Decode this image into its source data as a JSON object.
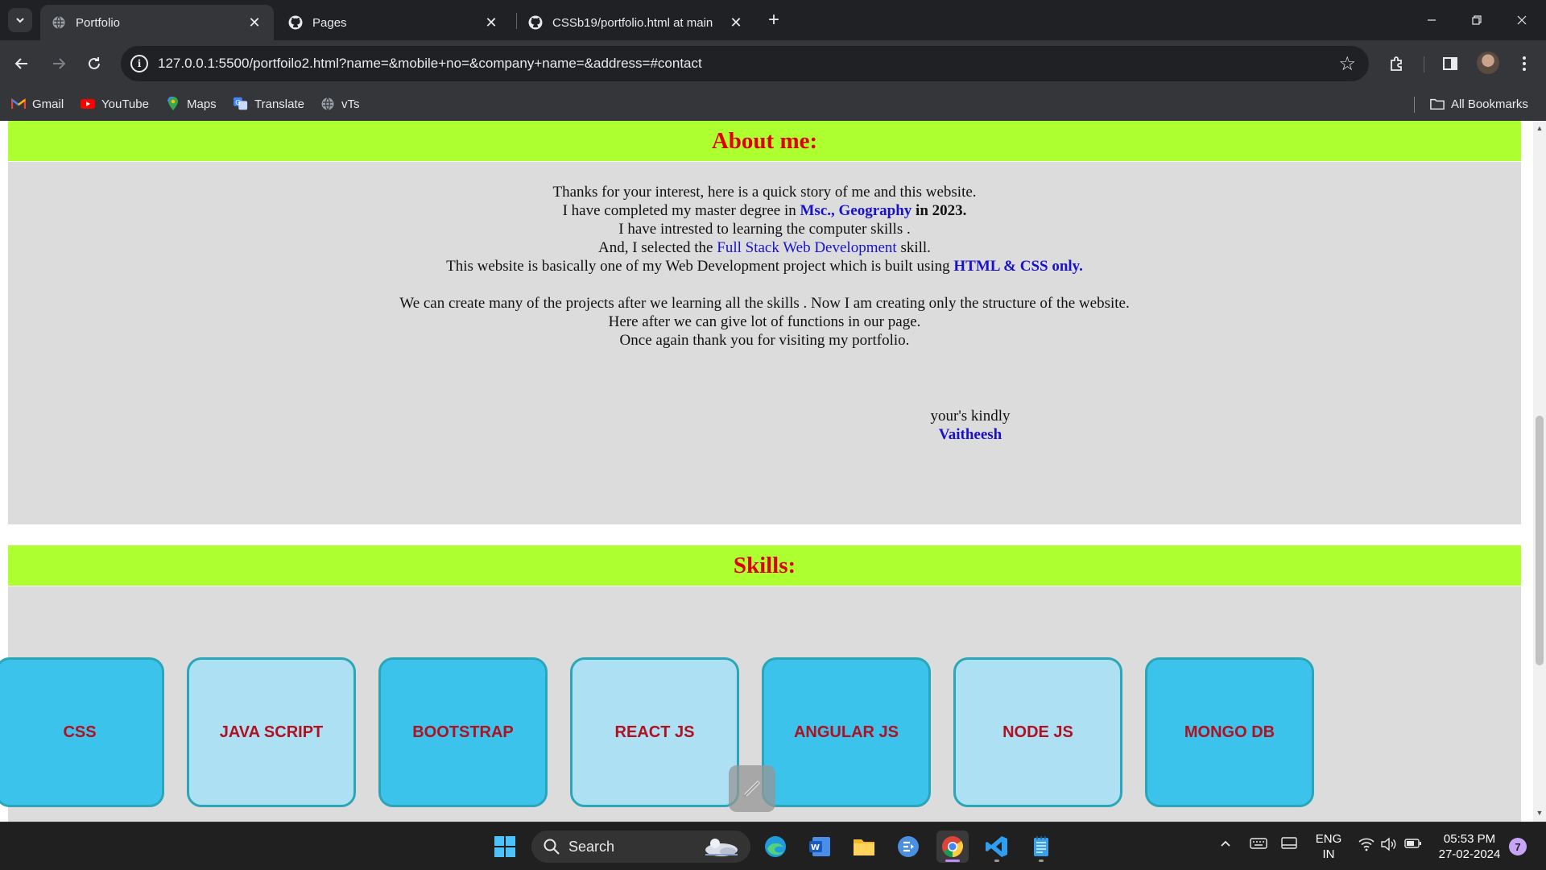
{
  "browser": {
    "tabs": [
      {
        "title": "Portfolio",
        "active": true
      },
      {
        "title": "Pages",
        "active": false
      },
      {
        "title": "CSSb19/portfolio.html at main",
        "active": false
      }
    ],
    "url": "127.0.0.1:5500/portfoilo2.html?name=&mobile+no=&company+name=&address=#contact",
    "bookmarks": [
      "Gmail",
      "YouTube",
      "Maps",
      "Translate",
      "vTs"
    ],
    "all_bookmarks_label": "All Bookmarks"
  },
  "page": {
    "about": {
      "heading": "About me:",
      "line1": "Thanks for your interest, here is a quick story of me and this website.",
      "line2_prefix": "I have completed my master degree in ",
      "line2_degree": "Msc., Geography",
      "line2_year": " in 2023.",
      "line3": "I have intrested to learning the computer skills .",
      "line4_prefix": "And, I selected the ",
      "line4_skill": "Full Stack Web Development",
      "line4_suffix": " skill.",
      "line5_prefix": "This website is basically one of my Web Development project which is built using ",
      "line5_tech": "HTML & CSS only.",
      "line6": "We can create many of the projects after we learning all the skills . Now I am creating only the structure of the website.",
      "line7": "Here after we can give lot of functions in our page.",
      "line8": "Once again thank you for visiting my portfolio.",
      "closing": "your's kindly",
      "signature": "Vaitheesh"
    },
    "skills": {
      "heading": "Skills:",
      "items": [
        "CSS",
        "JAVA SCRIPT",
        "BOOTSTRAP",
        "REACT JS",
        "ANGULAR JS",
        "NODE JS",
        "MONGO DB"
      ]
    }
  },
  "taskbar": {
    "search_placeholder": "Search",
    "language_top": "ENG",
    "language_bottom": "IN",
    "time": "05:53 PM",
    "date": "27-02-2024",
    "notifications": "7"
  },
  "colors": {
    "section_header_bg": "#adff2f",
    "section_header_text": "#e00000",
    "section_body_bg": "#dcdcdc",
    "highlight_text": "#1a12c8",
    "skill_dark": "#3bc3ec",
    "skill_light": "#aee0f4",
    "skill_text": "#b01020"
  }
}
